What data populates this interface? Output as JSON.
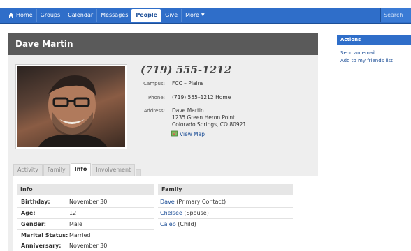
{
  "nav": {
    "items": [
      {
        "label": "Home",
        "icon": "home-icon"
      },
      {
        "label": "Groups"
      },
      {
        "label": "Calendar"
      },
      {
        "label": "Messages"
      },
      {
        "label": "People",
        "active": true
      },
      {
        "label": "Give"
      },
      {
        "label": "More",
        "dropdown": true
      }
    ],
    "search_placeholder": "Search",
    "colors": {
      "bar": "#2f6ec9",
      "active_text": "#1d4f97"
    }
  },
  "profile": {
    "name": "Dave Martin",
    "phone_main": "(719) 555-1212",
    "campus_label": "Campus:",
    "campus_value": "FCC – Plains",
    "phone_label": "Phone:",
    "phone_value": "(719) 555–1212 Home",
    "address_label": "Address:",
    "address_lines": [
      "Dave Martin",
      "1235 Green Heron Point",
      "Colorado Springs, CO 80921"
    ],
    "map_link": "View Map"
  },
  "tabs": [
    {
      "label": "Activity"
    },
    {
      "label": "Family"
    },
    {
      "label": "Info",
      "active": true
    },
    {
      "label": "Involvement"
    }
  ],
  "info": {
    "heading": "Info",
    "rows": [
      {
        "label": "Birthday:",
        "value": "November 30"
      },
      {
        "label": "Age:",
        "value": "12"
      },
      {
        "label": "Gender:",
        "value": "Male"
      },
      {
        "label": "Marital Status:",
        "value": "Married"
      },
      {
        "label": "Anniversary:",
        "value": "November 30"
      }
    ]
  },
  "family": {
    "heading": "Family",
    "members": [
      {
        "name": "Dave",
        "role": "(Primary Contact)"
      },
      {
        "name": "Chelsee",
        "role": "(Spouse)"
      },
      {
        "name": "Caleb",
        "role": "(Child)"
      }
    ]
  },
  "actions": {
    "heading": "Actions",
    "links": [
      "Send an email",
      "Add to my friends list"
    ]
  }
}
